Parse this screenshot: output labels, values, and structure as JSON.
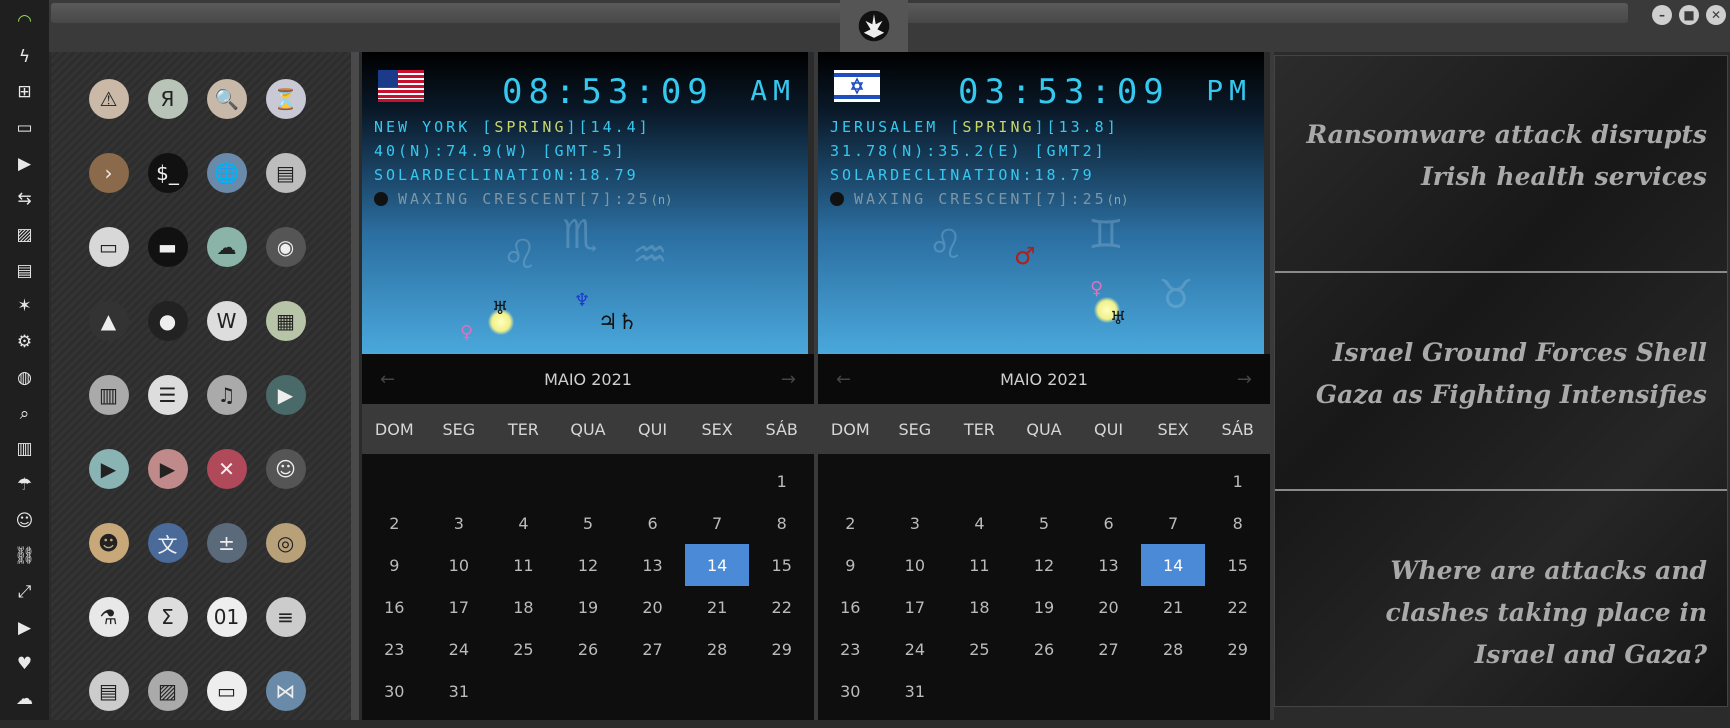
{
  "dock": {
    "icons": [
      "wifi-icon",
      "lightning-icon",
      "windows-icon",
      "archive-icon",
      "play-icon",
      "translate-icon",
      "image-icon",
      "news-icon",
      "rebel-icon",
      "settings-icon",
      "globe-icon",
      "search-icon",
      "map-icon",
      "umbrella-icon",
      "contact-icon",
      "link-icon",
      "expand-icon",
      "youtube-icon",
      "heart-icon",
      "cloud-icon"
    ]
  },
  "apps": [
    {
      "name": "warning-app-icon",
      "glyph": "⚠",
      "bg": "#c9b9a6"
    },
    {
      "name": "yandex-app-icon",
      "glyph": "Я",
      "bg": "#b9c4b9"
    },
    {
      "name": "search-app-icon",
      "glyph": "🔍",
      "bg": "#c8b8a8"
    },
    {
      "name": "hourglass-app-icon",
      "glyph": "⏳",
      "bg": "#c9c9d6"
    },
    {
      "name": "terminal-arrow-app-icon",
      "glyph": "›",
      "bg": "#8a6a4a"
    },
    {
      "name": "console-app-icon",
      "glyph": "$_",
      "bg": "#111"
    },
    {
      "name": "web-globe-app-icon",
      "glyph": "🌐",
      "bg": "#6a8aaa"
    },
    {
      "name": "drive-app-icon",
      "glyph": "▤",
      "bg": "#bdbdbd"
    },
    {
      "name": "window-app-icon",
      "glyph": "▭",
      "bg": "#d8d8d8"
    },
    {
      "name": "bed-app-icon",
      "glyph": "▬",
      "bg": "#111"
    },
    {
      "name": "cloud-lock-app-icon",
      "glyph": "☁",
      "bg": "#8ab4a8"
    },
    {
      "name": "github-app-icon",
      "glyph": "◉",
      "bg": "#555"
    },
    {
      "name": "starfleet-app-icon",
      "glyph": "▲",
      "bg": "#333"
    },
    {
      "name": "deathstar-app-icon",
      "glyph": "●",
      "bg": "#222"
    },
    {
      "name": "wikipedia-app-icon",
      "glyph": "W",
      "bg": "#ddd"
    },
    {
      "name": "worldmap-app-icon",
      "glyph": "▦",
      "bg": "#b8c4a8"
    },
    {
      "name": "files-app-icon",
      "glyph": "▥",
      "bg": "#aaa"
    },
    {
      "name": "notebook-app-icon",
      "glyph": "☰",
      "bg": "#ddd"
    },
    {
      "name": "music-app-icon",
      "glyph": "♫",
      "bg": "#aaa"
    },
    {
      "name": "video-app-icon",
      "glyph": "▶",
      "bg": "#4a6a6a"
    },
    {
      "name": "player-app-icon",
      "glyph": "▶",
      "bg": "#8ab4b4"
    },
    {
      "name": "youtube-app-icon",
      "glyph": "▶",
      "bg": "#c08a8a"
    },
    {
      "name": "close-app-icon",
      "glyph": "✕",
      "bg": "#b04a5a"
    },
    {
      "name": "avatar-app-icon",
      "glyph": "☺",
      "bg": "#555"
    },
    {
      "name": "droid-app-icon",
      "glyph": "☻",
      "bg": "#c8a878"
    },
    {
      "name": "translate-app-icon",
      "glyph": "文",
      "bg": "#4a6a9a"
    },
    {
      "name": "calculator-app-icon",
      "glyph": "±",
      "bg": "#5a6a7a"
    },
    {
      "name": "camera-app-icon",
      "glyph": "◎",
      "bg": "#b8a078"
    },
    {
      "name": "lab-app-icon",
      "glyph": "⚗",
      "bg": "#e8e8e8"
    },
    {
      "name": "sigma-app-icon",
      "glyph": "Σ",
      "bg": "#ddd"
    },
    {
      "name": "binary-app-icon",
      "glyph": "01",
      "bg": "#eee"
    },
    {
      "name": "text-app-icon",
      "glyph": "≡",
      "bg": "#ccc"
    },
    {
      "name": "document-app-icon",
      "glyph": "▤",
      "bg": "#ccc"
    },
    {
      "name": "image-app-icon",
      "glyph": "▨",
      "bg": "#aaa"
    },
    {
      "name": "presentation-app-icon",
      "glyph": "▭",
      "bg": "#eee"
    },
    {
      "name": "vscode-app-icon",
      "glyph": "⋈",
      "bg": "#6a8aaa"
    }
  ],
  "clocks": {
    "ny": {
      "time": "08:53:09",
      "ampm": "AM",
      "l1a": "NEW YORK [",
      "l1b": "SPRING",
      "l1c": "][14.4]",
      "l2": "40(N):74.9(W) [GMT-5]",
      "l3": "SOLARDECLINATION:18.79",
      "l4": "WAXING CRESCENT[7]:25",
      "l4n": "(n)"
    },
    "jer": {
      "time": "03:53:09",
      "ampm": "PM",
      "l1a": "JERUSALEM [",
      "l1b": "SPRING",
      "l1c": "][13.8]",
      "l2": "31.78(N):35.2(E) [GMT2]",
      "l3": "SOLARDECLINATION:18.79",
      "l4": "WAXING CRESCENT[7]:25",
      "l4n": "(n)"
    }
  },
  "calendar": {
    "month": "MAIO 2021",
    "prev": "←",
    "next": "→",
    "weekdays": [
      "DOM",
      "SEG",
      "TER",
      "QUA",
      "QUI",
      "SEX",
      "SÁB"
    ],
    "days": [
      "",
      "",
      "",
      "",
      "",
      "",
      "1",
      "2",
      "3",
      "4",
      "5",
      "6",
      "7",
      "8",
      "9",
      "10",
      "11",
      "12",
      "13",
      "14",
      "15",
      "16",
      "17",
      "18",
      "19",
      "20",
      "21",
      "22",
      "23",
      "24",
      "25",
      "26",
      "27",
      "28",
      "29",
      "30",
      "31"
    ],
    "today": "14"
  },
  "news": [
    "Ransomware attack disrupts Irish health services",
    "Israel Ground Forces Shell Gaza as Fighting Intensifies",
    "Where are attacks and clashes taking place in Israel and Gaza?"
  ],
  "window_controls": {
    "minimize": "–",
    "maximize": "■",
    "close": "✕"
  }
}
